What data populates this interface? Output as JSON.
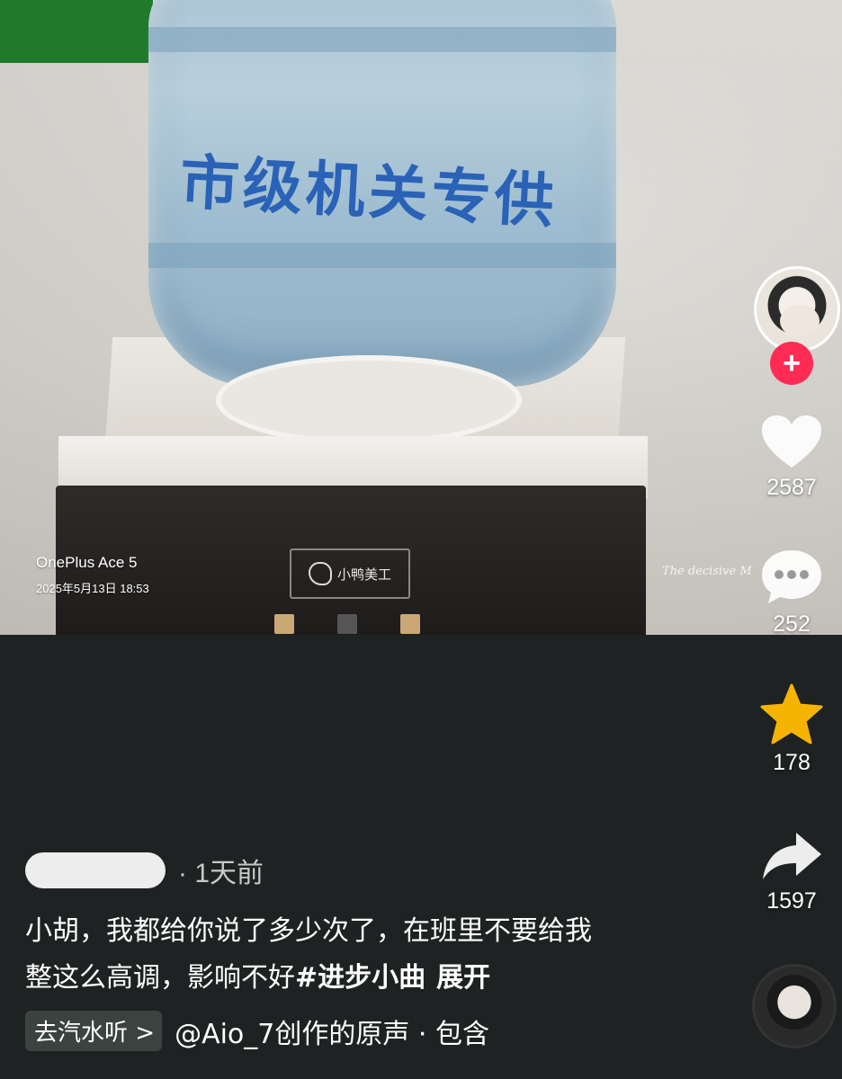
{
  "photo": {
    "bottle_label": "市级机关专供",
    "brand_label": "小鸭美工",
    "watermark_model": "OnePlus Ace 5",
    "watermark_date": "2025年5月13日 18:53",
    "signature": "The decisive M"
  },
  "rail": {
    "follow_icon": "plus-icon",
    "like_count": "2587",
    "comment_count": "252",
    "favorite_count": "178",
    "share_count": "1597",
    "colors": {
      "follow": "#fe2c55",
      "favorite": "#f5b400",
      "like": "#ffffff"
    }
  },
  "post": {
    "time": "· 1天前",
    "caption_line1": "小胡，我都给你说了多少次了，在班里不要给我",
    "caption_line2": "整这么高调，影响不好",
    "hashtag": "#进步小曲",
    "expand": "展开",
    "music_chip": "去汽水听 >",
    "music_text": "@Aio_7创作的原声 · 包含"
  }
}
